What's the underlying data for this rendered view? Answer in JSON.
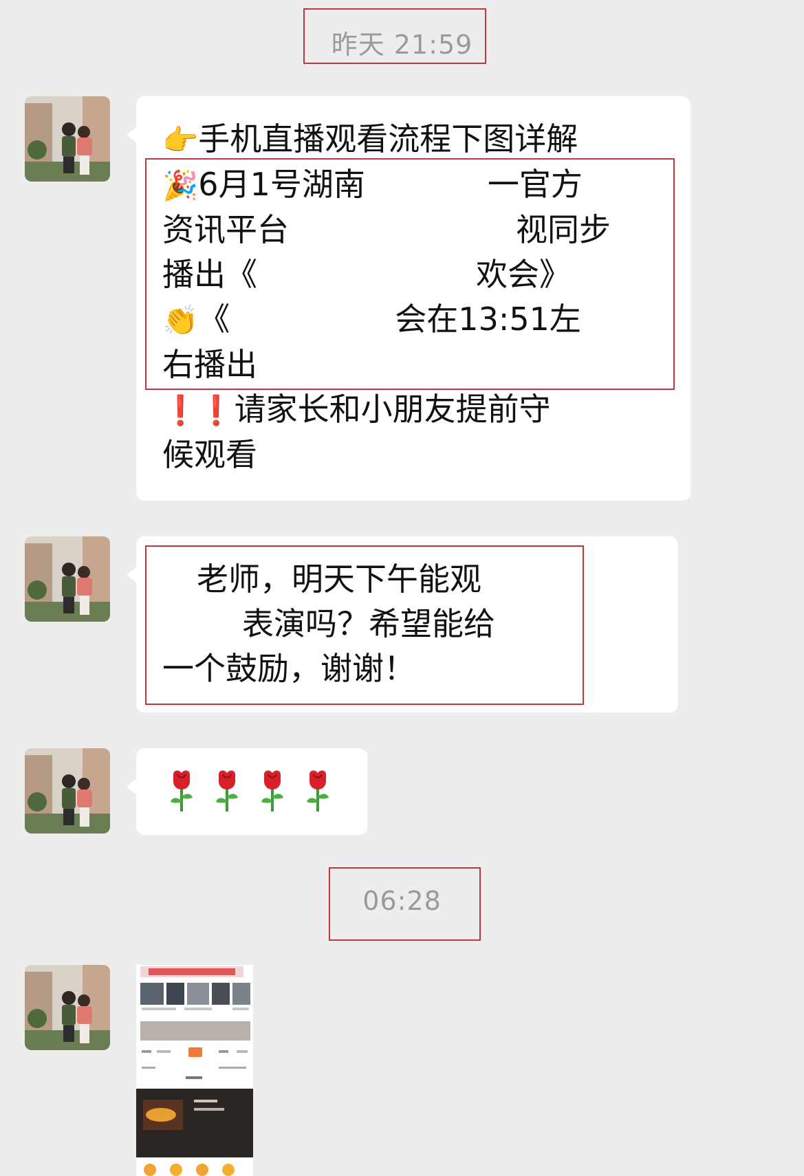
{
  "timestamps": {
    "first": "昨天 21:59",
    "second": "06:28"
  },
  "messages": [
    {
      "lines": [
        "手机直播观看流程下图详解",
        "6月1号湖南",
        "一官方",
        "资讯平台",
        "视同步",
        "播出《",
        "欢会》",
        "《",
        "会在13:51左",
        "右播出",
        "请家长和小朋友提前守",
        "候观看"
      ],
      "emoji": {
        "pointing": "backhand-index-pointing-right-icon",
        "party": "party-popper-icon",
        "clap": "clapping-hands-icon",
        "exclaim": "red-exclamation-icon"
      }
    },
    {
      "lines": [
        "老师，明天下午能观",
        "表演吗？希望能给",
        "一个鼓励，谢谢！"
      ]
    },
    {
      "flowers": [
        "rose-icon",
        "rose-icon",
        "rose-icon",
        "rose-icon"
      ]
    }
  ],
  "colors": {
    "background": "#ededed",
    "bubble": "#ffffff",
    "highlight_box": "#b83a3a",
    "timestamp_text": "#9a9a9a"
  }
}
